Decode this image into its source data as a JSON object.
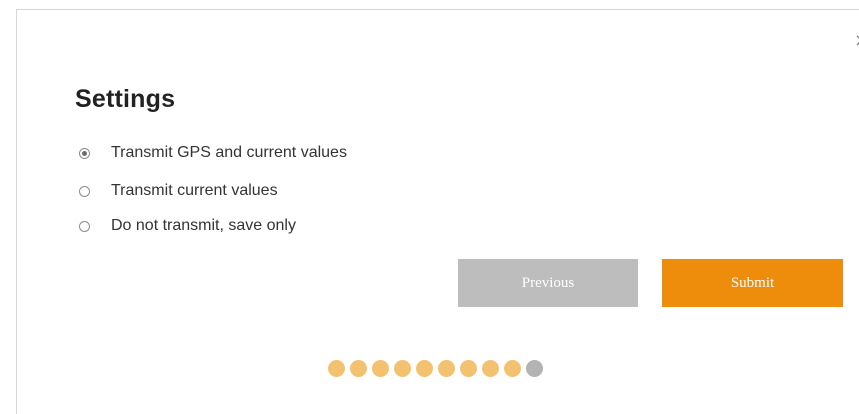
{
  "dialog": {
    "close_glyph": "×",
    "title": "Settings",
    "options": [
      {
        "label": "Transmit GPS and current values",
        "checked": true
      },
      {
        "label": "Transmit current values",
        "checked": false
      },
      {
        "label": "Do not transmit, save only",
        "checked": false
      }
    ],
    "buttons": {
      "previous_label": "Previous",
      "submit_label": "Submit"
    },
    "progress": {
      "total_steps": 10,
      "completed_steps": 9
    }
  },
  "colors": {
    "accent": "#ee8c0c",
    "disabled_button": "#bdbdbd",
    "dot_completed": "#f3c271",
    "dot_current": "#b3b3b3"
  }
}
